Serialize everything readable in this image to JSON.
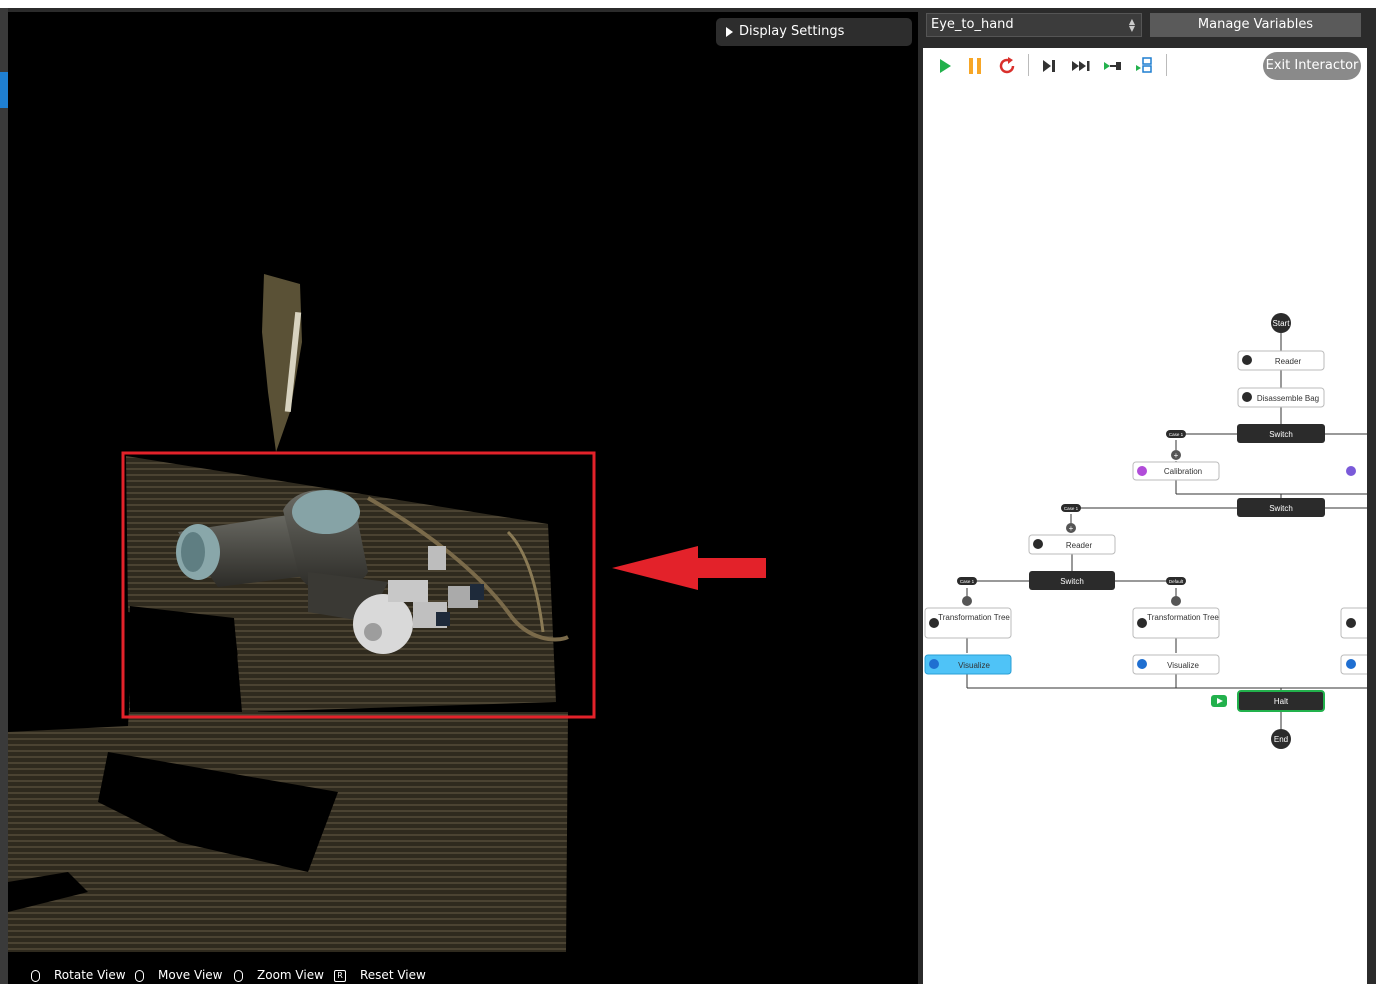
{
  "viewport": {
    "display_settings_label": "Display Settings",
    "hints": [
      {
        "icon": "mouse-left-icon",
        "label": "Rotate View"
      },
      {
        "icon": "mouse-right-icon",
        "label": "Move View"
      },
      {
        "icon": "mouse-wheel-icon",
        "label": "Zoom View"
      },
      {
        "icon": "r-key-icon",
        "key": "R",
        "label": "Reset View"
      }
    ],
    "annotation_color": "#e3222a"
  },
  "panel": {
    "project_select": "Eye_to_hand",
    "manage_variables": "Manage Variables",
    "exit_interactor": "Exit Interactor",
    "toolbar": [
      {
        "name": "run-icon",
        "color": "#22b14c"
      },
      {
        "name": "pause-icon",
        "color": "#f7a626"
      },
      {
        "name": "restart-icon",
        "color": "#d9302c"
      },
      {
        "name": "step-icon",
        "color": "#333333"
      },
      {
        "name": "fast-forward-icon",
        "color": "#333333"
      },
      {
        "name": "run-to-icon",
        "color": "#22b14c"
      },
      {
        "name": "debug-icon",
        "color": "#1f7fd1"
      }
    ]
  },
  "flow": {
    "start": "Start",
    "end": "End",
    "reader1": "Reader",
    "disassemble": "Disassemble Bag",
    "switch1": "Switch",
    "case1a": "Case 1",
    "calibration": "Calibration",
    "switch2": "Switch",
    "case1b": "Case 1",
    "reader2": "Reader",
    "switch3": "Switch",
    "case1c": "Case 1",
    "default": "Default",
    "tt1": "Transformation Tree",
    "tt2": "Transformation Tree",
    "visualize1": "Visualize",
    "visualize2": "Visualize",
    "halt": "Halt"
  }
}
